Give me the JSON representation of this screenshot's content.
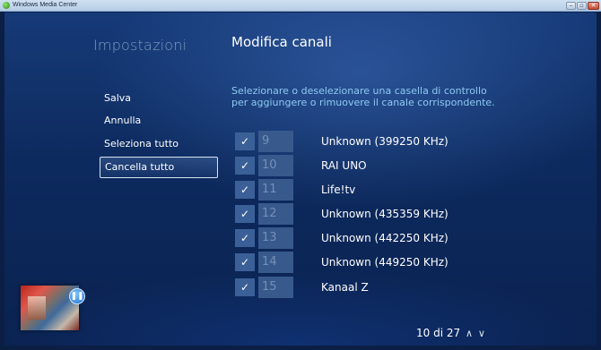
{
  "window": {
    "title": "Windows Media Center",
    "minimize_glyph": "–",
    "maximize_glyph": "▫",
    "close_glyph": "✕"
  },
  "section_title": "Impostazioni",
  "page_title": "Modifica canali",
  "menu": [
    {
      "label": "Salva",
      "selected": false
    },
    {
      "label": "Annulla",
      "selected": false
    },
    {
      "label": "Seleziona tutto",
      "selected": false
    },
    {
      "label": "Cancella tutto",
      "selected": true
    }
  ],
  "instructions": "Selezionare o deselezionare una casella di controllo per aggiungere o rimuovere il canale corrispondente.",
  "channels": [
    {
      "checked": true,
      "number": "9",
      "name": "Unknown (399250 KHz)"
    },
    {
      "checked": true,
      "number": "10",
      "name": "RAI UNO"
    },
    {
      "checked": true,
      "number": "11",
      "name": "Life!tv"
    },
    {
      "checked": true,
      "number": "12",
      "name": "Unknown (435359 KHz)"
    },
    {
      "checked": true,
      "number": "13",
      "name": "Unknown (442250 KHz)"
    },
    {
      "checked": true,
      "number": "14",
      "name": "Unknown (449250 KHz)"
    },
    {
      "checked": true,
      "number": "15",
      "name": "Kanaal Z"
    }
  ],
  "check_glyph": "✓",
  "pager": {
    "text": "10 di 27",
    "up_glyph": "∧",
    "down_glyph": "∨"
  },
  "now_playing": {
    "pause_glyph": "❚❚",
    "icon": "pause-icon"
  },
  "colors": {
    "background": "#0d2a5e",
    "accent_text": "#8ec9f2",
    "checkbox": "#3b6098"
  }
}
